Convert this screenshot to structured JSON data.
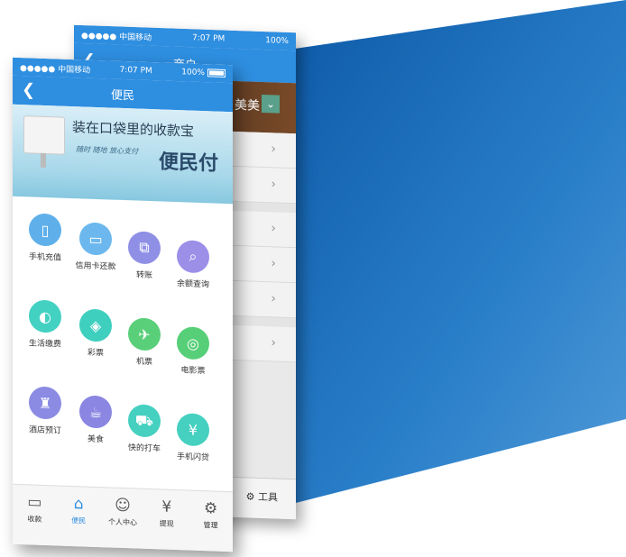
{
  "colors": {
    "accent": "#2e8ee0",
    "bg_band": "#1f6fb8"
  },
  "back_phone": {
    "carrier": "●●●●● 中国移动",
    "time": "7:07 PM",
    "battery": "100%",
    "title": "商户",
    "banner_text": "美美",
    "tab_tool_label": "工具"
  },
  "front_phone": {
    "carrier": "●●●●● 中国移动",
    "time": "7:07 PM",
    "battery": "100%",
    "title": "便民",
    "promo": {
      "line1": "装在口袋里的收款宝",
      "line2": "随时 随地 放心支付",
      "line3": "便民付"
    },
    "services": [
      {
        "label": "手机充值",
        "icon": "phone-icon",
        "color": "#5fb0ea"
      },
      {
        "label": "信用卡还款",
        "icon": "card-icon",
        "color": "#6cb8ee"
      },
      {
        "label": "转账",
        "icon": "transfer-icon",
        "color": "#8f8fe6"
      },
      {
        "label": "余额查询",
        "icon": "search-icon",
        "color": "#9b8fe8"
      },
      {
        "label": "生活缴费",
        "icon": "bulb-icon",
        "color": "#43d1c2"
      },
      {
        "label": "彩票",
        "icon": "lottery-icon",
        "color": "#3fcfbf"
      },
      {
        "label": "机票",
        "icon": "plane-icon",
        "color": "#59cf7a"
      },
      {
        "label": "电影票",
        "icon": "film-icon",
        "color": "#57cf78"
      },
      {
        "label": "酒店预订",
        "icon": "hotel-icon",
        "color": "#8b8be4"
      },
      {
        "label": "美食",
        "icon": "food-icon",
        "color": "#8a86e2"
      },
      {
        "label": "快的打车",
        "icon": "car-icon",
        "color": "#45d0c0"
      },
      {
        "label": "手机闪贷",
        "icon": "loan-icon",
        "color": "#45d0c0"
      }
    ],
    "tabs": [
      {
        "label": "收款",
        "icon": "receive-icon"
      },
      {
        "label": "便民",
        "icon": "home-icon"
      },
      {
        "label": "个人中心",
        "icon": "user-icon"
      },
      {
        "label": "提现",
        "icon": "withdraw-icon"
      },
      {
        "label": "管理",
        "icon": "gear-icon"
      }
    ]
  }
}
